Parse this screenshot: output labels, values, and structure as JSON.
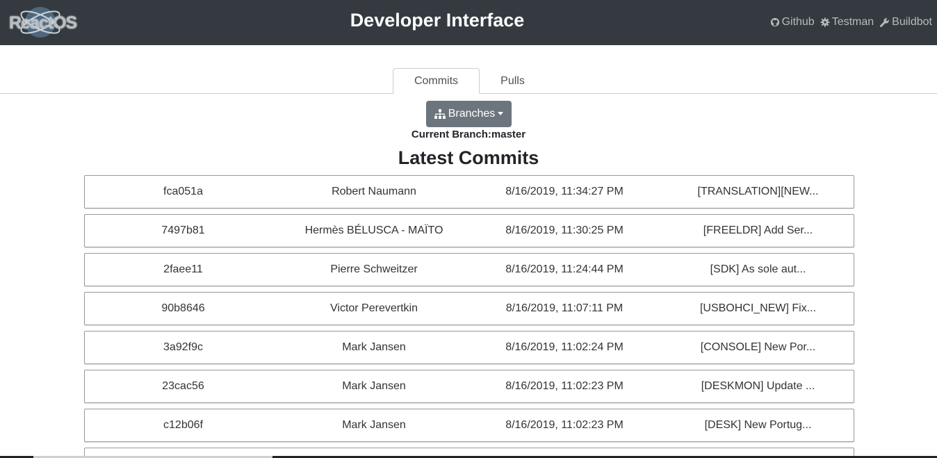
{
  "header": {
    "logo_text": "ReactOS",
    "title": "Developer Interface",
    "links": [
      {
        "label": "Github",
        "icon": "github-icon"
      },
      {
        "label": "Testman",
        "icon": "gear-icon"
      },
      {
        "label": "Buildbot",
        "icon": "wrench-icon"
      }
    ]
  },
  "tabs": [
    {
      "label": "Commits",
      "active": true
    },
    {
      "label": "Pulls",
      "active": false
    }
  ],
  "branches_button": {
    "label": "Branches",
    "icon": "sitemap-icon"
  },
  "current_branch": "Current Branch:master",
  "section_title": "Latest Commits",
  "commits": [
    {
      "sha": "fca051a",
      "author": "Robert Naumann",
      "date": "8/16/2019, 11:34:27 PM",
      "message": "[TRANSLATION][NEW..."
    },
    {
      "sha": "7497b81",
      "author": "Hermès BÉLUSCA - MAÏTO",
      "date": "8/16/2019, 11:30:25 PM",
      "message": "[FREELDR] Add Ser..."
    },
    {
      "sha": "2faee11",
      "author": "Pierre Schweitzer",
      "date": "8/16/2019, 11:24:44 PM",
      "message": "[SDK] As sole aut..."
    },
    {
      "sha": "90b8646",
      "author": "Victor Perevertkin",
      "date": "8/16/2019, 11:07:11 PM",
      "message": "[USBOHCI_NEW] Fix..."
    },
    {
      "sha": "3a92f9c",
      "author": "Mark Jansen",
      "date": "8/16/2019, 11:02:24 PM",
      "message": "[CONSOLE] New Por..."
    },
    {
      "sha": "23cac56",
      "author": "Mark Jansen",
      "date": "8/16/2019, 11:02:23 PM",
      "message": "[DESKMON] Update ..."
    },
    {
      "sha": "c12b06f",
      "author": "Mark Jansen",
      "date": "8/16/2019, 11:02:23 PM",
      "message": "[DESK] New Portug..."
    }
  ]
}
